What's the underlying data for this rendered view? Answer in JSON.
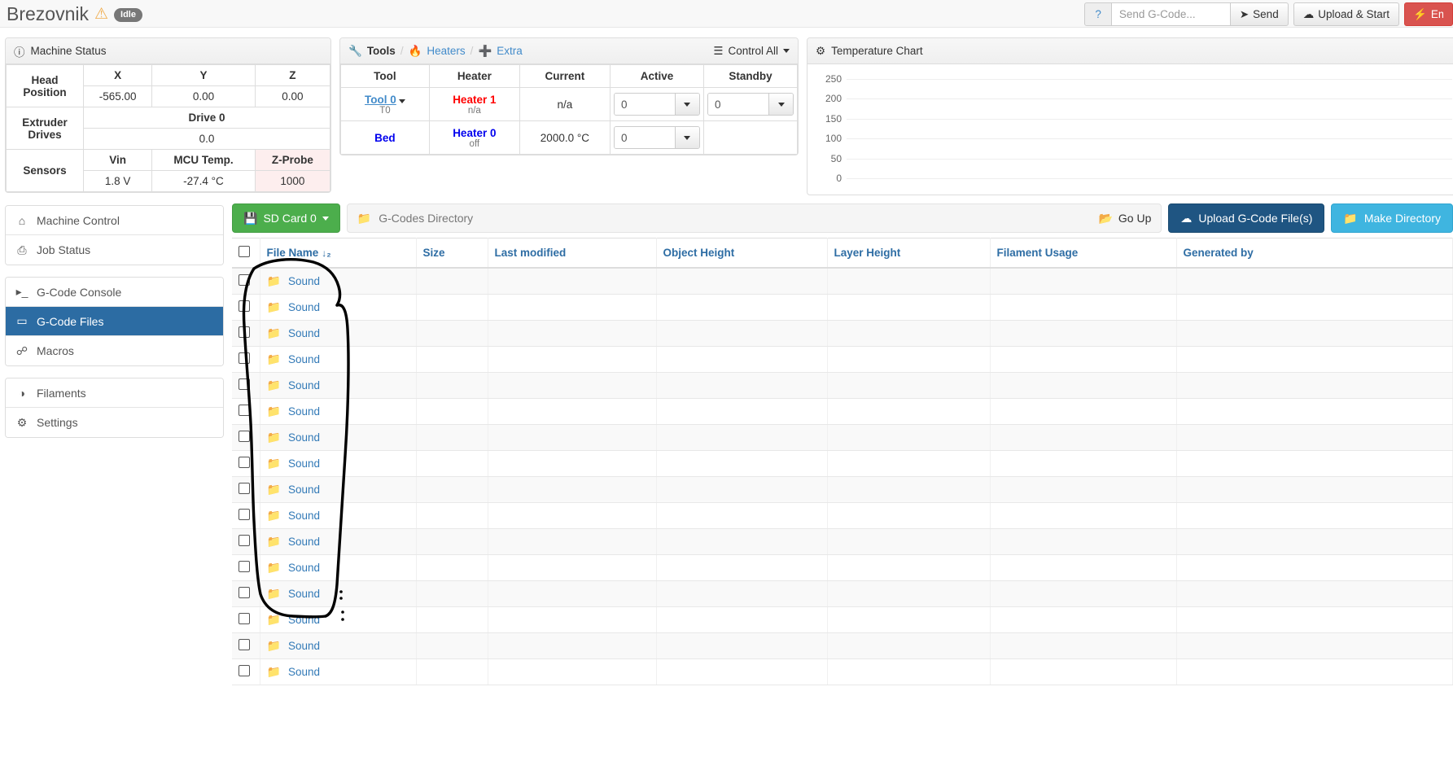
{
  "navbar": {
    "brand": "Brezovnik",
    "warn_icon": "warning-triangle-icon",
    "status_badge": "Idle",
    "help_label": "?",
    "gcode_placeholder": "Send G-Code...",
    "gcode_value": "",
    "send_label": "Send",
    "upload_start_label": "Upload & Start",
    "estop_label": "Emergency Stop"
  },
  "machine_status": {
    "title": "Machine Status",
    "head_position_label": "Head Position",
    "axes": [
      "X",
      "Y",
      "Z"
    ],
    "axis_values": [
      "-565.00",
      "0.00",
      "0.00"
    ],
    "extruder_label": "Extruder Drives",
    "drive_header": "Drive 0",
    "drive_value": "0.0",
    "sensors_label": "Sensors",
    "sensor_headers": [
      "Vin",
      "MCU Temp.",
      "Z-Probe"
    ],
    "sensor_values": [
      "1.8 V",
      "-27.4 °C",
      "1000"
    ]
  },
  "tools": {
    "crumb_tools": "Tools",
    "crumb_heaters": "Heaters",
    "crumb_extra": "Extra",
    "control_all": "Control All",
    "headers": [
      "Tool",
      "Heater",
      "Current",
      "Active",
      "Standby"
    ],
    "rows": [
      {
        "tool": "Tool 0",
        "tool_sub": "T0",
        "heater": "Heater 1",
        "heater_sub": "n/a",
        "heater_color": "#ff0000",
        "current": "n/a",
        "active": "0",
        "standby": "0",
        "has_standby": true
      },
      {
        "tool": "Bed",
        "tool_sub": "",
        "heater": "Heater 0",
        "heater_sub": "off",
        "heater_color": "#0000ee",
        "current": "2000.0 °C",
        "active": "0",
        "standby": "",
        "has_standby": false
      }
    ]
  },
  "temperature_chart": {
    "title": "Temperature Chart"
  },
  "chart_data": {
    "type": "line",
    "title": "Temperature Chart",
    "xlabel": "",
    "ylabel": "",
    "yticks": [
      250,
      200,
      150,
      100,
      50,
      0
    ],
    "ylim": [
      0,
      280
    ],
    "grid": true,
    "legend": "none",
    "series": []
  },
  "sidebar": {
    "groups": [
      {
        "items": [
          {
            "label": "Machine Control",
            "icon": "home-icon",
            "active": false
          },
          {
            "label": "Job Status",
            "icon": "printer-icon",
            "active": false
          }
        ]
      },
      {
        "items": [
          {
            "label": "G-Code Console",
            "icon": "terminal-icon",
            "active": false
          },
          {
            "label": "G-Code Files",
            "icon": "hdd-icon",
            "active": true
          },
          {
            "label": "Macros",
            "icon": "link-icon",
            "active": false
          }
        ]
      },
      {
        "items": [
          {
            "label": "Filaments",
            "icon": "globe-icon",
            "active": false
          },
          {
            "label": "Settings",
            "icon": "gear-icon",
            "active": false
          }
        ]
      }
    ]
  },
  "file_toolbar": {
    "sdcard_label": "SD Card 0",
    "path_label": "G-Codes Directory",
    "goup_label": "Go Up",
    "upload_label": "Upload G-Code File(s)",
    "makedir_label": "Make Directory"
  },
  "file_table": {
    "headers": [
      "File Name",
      "Size",
      "Last modified",
      "Object Height",
      "Layer Height",
      "Filament Usage",
      "Generated by"
    ],
    "sort_column": "File Name",
    "sort_icon": "sort-alpha-desc-icon",
    "rows": [
      {
        "name": "Sound",
        "size": "",
        "modified": "",
        "object_height": "",
        "layer_height": "",
        "filament": "",
        "generated_by": ""
      },
      {
        "name": "Sound",
        "size": "",
        "modified": "",
        "object_height": "",
        "layer_height": "",
        "filament": "",
        "generated_by": ""
      },
      {
        "name": "Sound",
        "size": "",
        "modified": "",
        "object_height": "",
        "layer_height": "",
        "filament": "",
        "generated_by": ""
      },
      {
        "name": "Sound",
        "size": "",
        "modified": "",
        "object_height": "",
        "layer_height": "",
        "filament": "",
        "generated_by": ""
      },
      {
        "name": "Sound",
        "size": "",
        "modified": "",
        "object_height": "",
        "layer_height": "",
        "filament": "",
        "generated_by": ""
      },
      {
        "name": "Sound",
        "size": "",
        "modified": "",
        "object_height": "",
        "layer_height": "",
        "filament": "",
        "generated_by": ""
      },
      {
        "name": "Sound",
        "size": "",
        "modified": "",
        "object_height": "",
        "layer_height": "",
        "filament": "",
        "generated_by": ""
      },
      {
        "name": "Sound",
        "size": "",
        "modified": "",
        "object_height": "",
        "layer_height": "",
        "filament": "",
        "generated_by": ""
      },
      {
        "name": "Sound",
        "size": "",
        "modified": "",
        "object_height": "",
        "layer_height": "",
        "filament": "",
        "generated_by": ""
      },
      {
        "name": "Sound",
        "size": "",
        "modified": "",
        "object_height": "",
        "layer_height": "",
        "filament": "",
        "generated_by": ""
      },
      {
        "name": "Sound",
        "size": "",
        "modified": "",
        "object_height": "",
        "layer_height": "",
        "filament": "",
        "generated_by": ""
      },
      {
        "name": "Sound",
        "size": "",
        "modified": "",
        "object_height": "",
        "layer_height": "",
        "filament": "",
        "generated_by": ""
      },
      {
        "name": "Sound",
        "size": "",
        "modified": "",
        "object_height": "",
        "layer_height": "",
        "filament": "",
        "generated_by": ""
      },
      {
        "name": "Sound",
        "size": "",
        "modified": "",
        "object_height": "",
        "layer_height": "",
        "filament": "",
        "generated_by": ""
      },
      {
        "name": "Sound",
        "size": "",
        "modified": "",
        "object_height": "",
        "layer_height": "",
        "filament": "",
        "generated_by": ""
      },
      {
        "name": "Sound",
        "size": "",
        "modified": "",
        "object_height": "",
        "layer_height": "",
        "filament": "",
        "generated_by": ""
      }
    ]
  },
  "annotation": {
    "shape": "hand-drawn-ellipse",
    "color": "#000000"
  }
}
